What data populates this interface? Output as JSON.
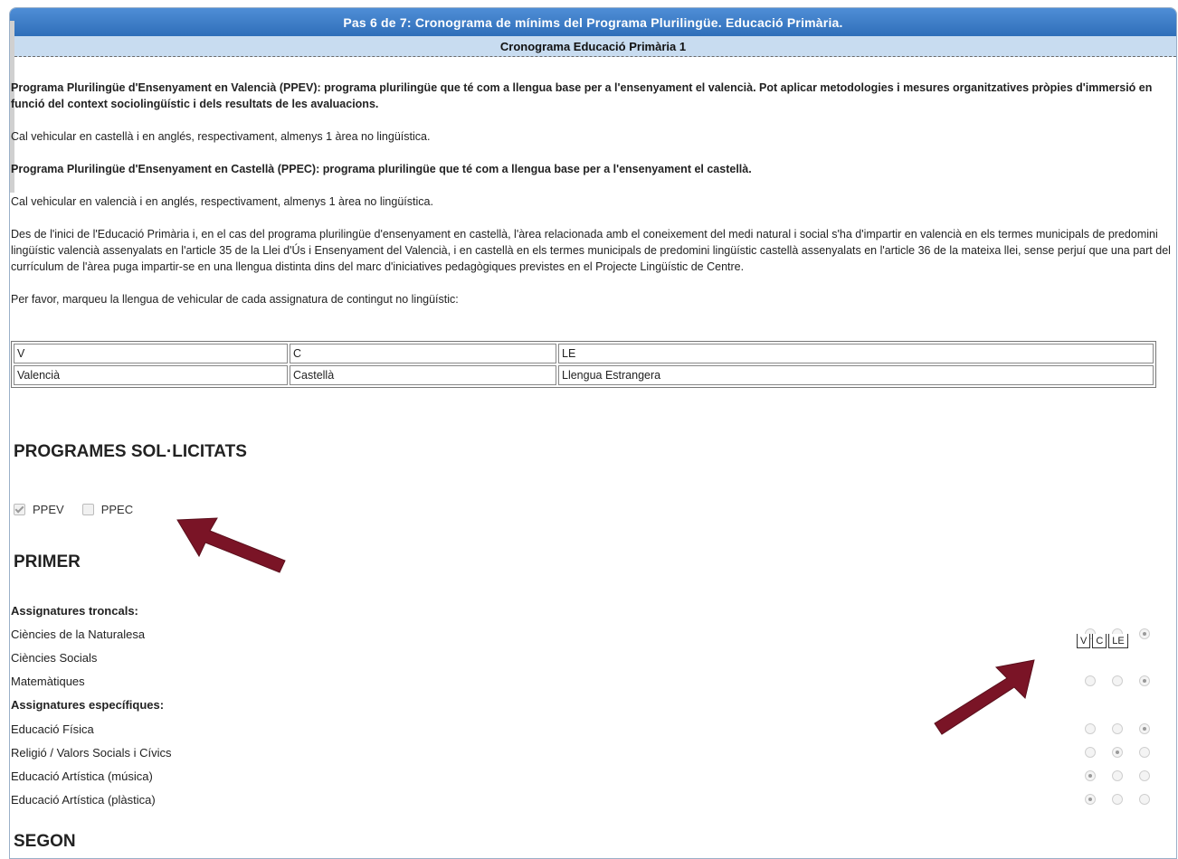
{
  "header": {
    "title": "Pas 6 de 7: Cronograma de mínims del Programa Plurilingüe. Educació Primària.",
    "subtitle": "Cronograma Educació Primària 1"
  },
  "intro": {
    "ppev_desc": "Programa Plurilingüe d'Ensenyament en Valencià (PPEV): programa plurilingüe que té com a llengua base per a l'ensenyament el valencià. Pot aplicar metodologies i mesures organitzatives pròpies d'immersió en funció del context sociolingüístic i dels resultats de les avaluacions.",
    "ppev_note": "Cal vehicular en castellà i en anglés, respectivament, almenys 1 àrea no lingüística.",
    "ppec_desc": "Programa Plurilingüe d'Ensenyament en Castellà (PPEC): programa plurilingüe que té com a llengua base per a l'ensenyament el castellà.",
    "ppec_note": "Cal vehicular en valencià i en anglés, respectivament, almenys 1 àrea no lingüística.",
    "long_note": "Des de l'inici de l'Educació Primària i, en el cas del programa plurilingüe d'ensenyament en castellà, l'àrea relacionada amb el coneixement del medi natural i social s'ha d'impartir en valencià en els termes municipals de predomini lingüístic valencià assenyalats en l'article 35 de la Llei d'Ús i Ensenyament del Valencià, i en castellà en els termes municipals de predomini lingüístic castellà assenyalats en l'article 36 de la mateixa llei, sense perjuí que una part del currículum de l'àrea puga impartir-se en una llengua distinta dins del marc d'iniciatives pedagògiques previstes en el Projecte Lingüístic de Centre.",
    "instruction": "Per favor, marqueu la llengua de vehicular de cada assignatura de contingut no lingüístic:"
  },
  "legend": {
    "codes": [
      "V",
      "C",
      "LE"
    ],
    "names": [
      "Valencià",
      "Castellà",
      "Llengua Estrangera"
    ]
  },
  "programs": {
    "heading": "PROGRAMES SOL·LICITATS",
    "items": [
      {
        "label": "PPEV",
        "checked": true
      },
      {
        "label": "PPEC",
        "checked": false
      }
    ]
  },
  "primer": {
    "heading": "PRIMER",
    "troncals_heading": "Assignatures troncals:",
    "especifiques_heading": "Assignatures específiques:",
    "troncals": [
      {
        "name": "Ciències de la Naturalesa",
        "selected": "LE"
      },
      {
        "name": "Ciències Socials",
        "selected": null
      },
      {
        "name": "Matemàtiques",
        "selected": "LE"
      }
    ],
    "especifiques": [
      {
        "name": "Educació Física",
        "selected": "LE"
      },
      {
        "name": "Religió / Valors Socials i Cívics",
        "selected": "C"
      },
      {
        "name": "Educació Artística (música)",
        "selected": "V"
      },
      {
        "name": "Educació Artística (plàstica)",
        "selected": "V"
      }
    ],
    "column_labels": [
      "V",
      "C",
      "LE"
    ]
  },
  "segon": {
    "heading": "SEGON"
  },
  "colors": {
    "title_bar": "#3a7cc6",
    "subtitle_bar": "#c8dcf0",
    "arrow": "#7a1426"
  }
}
